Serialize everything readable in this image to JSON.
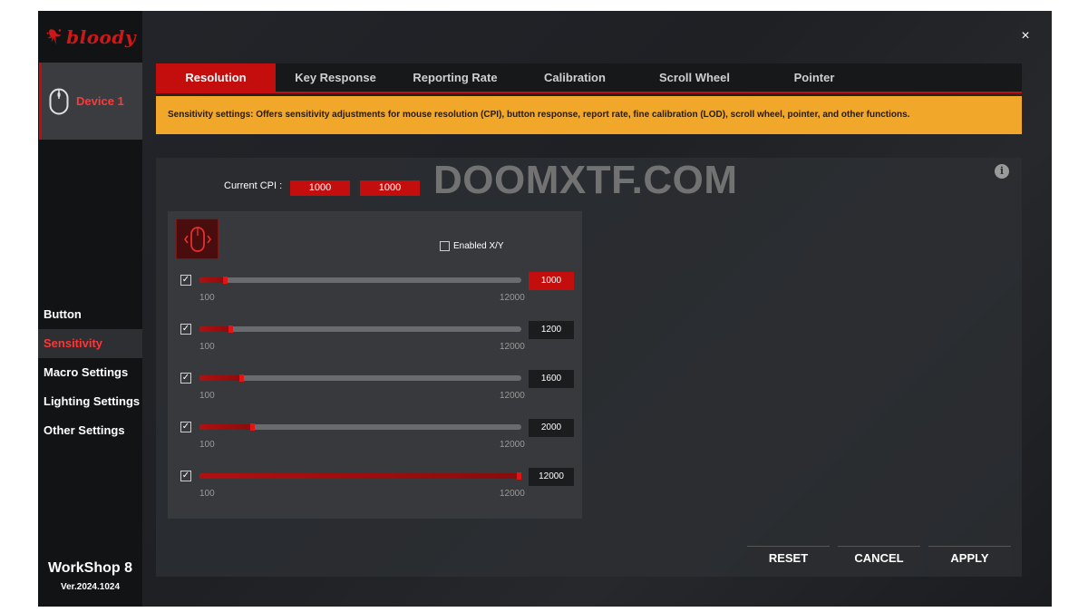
{
  "brand_logo": "bloody",
  "device": {
    "label": "Device 1",
    "icon": "mouse-icon"
  },
  "nav": {
    "items": [
      {
        "label": "Button",
        "active": false
      },
      {
        "label": "Sensitivity",
        "active": true
      },
      {
        "label": "Macro Settings",
        "active": false
      },
      {
        "label": "Lighting Settings",
        "active": false
      },
      {
        "label": "Other Settings",
        "active": false
      }
    ]
  },
  "footer": {
    "name": "WorkShop 8",
    "version": "Ver.2024.1024"
  },
  "window": {
    "close_icon": "×"
  },
  "tabs": [
    {
      "label": "Resolution",
      "active": true
    },
    {
      "label": "Key Response",
      "active": false
    },
    {
      "label": "Reporting Rate",
      "active": false
    },
    {
      "label": "Calibration",
      "active": false
    },
    {
      "label": "Scroll Wheel",
      "active": false
    },
    {
      "label": "Pointer",
      "active": false
    }
  ],
  "banner": "Sensitivity settings: Offers sensitivity adjustments for mouse resolution (CPI), button response, report rate, fine calibration (LOD), scroll wheel, pointer, and other functions.",
  "current_cpi": {
    "label": "Current CPI :",
    "x": "1000",
    "y": "1000"
  },
  "watermark": "DOOMXTF.COM",
  "enabled_xy": {
    "label": "Enabled X/Y",
    "checked": false
  },
  "cpi_levels": [
    {
      "checked": true,
      "value": "1000",
      "min": "100",
      "max": "12000",
      "active": true
    },
    {
      "checked": true,
      "value": "1200",
      "min": "100",
      "max": "12000",
      "active": false
    },
    {
      "checked": true,
      "value": "1600",
      "min": "100",
      "max": "12000",
      "active": false
    },
    {
      "checked": true,
      "value": "2000",
      "min": "100",
      "max": "12000",
      "active": false
    },
    {
      "checked": true,
      "value": "12000",
      "min": "100",
      "max": "12000",
      "active": false
    }
  ],
  "buttons": {
    "reset": "RESET",
    "cancel": "CANCEL",
    "apply": "APPLY"
  },
  "colors": {
    "accent": "#c40d0d",
    "banner": "#f1a72a",
    "active_nav": "#ff3535"
  }
}
